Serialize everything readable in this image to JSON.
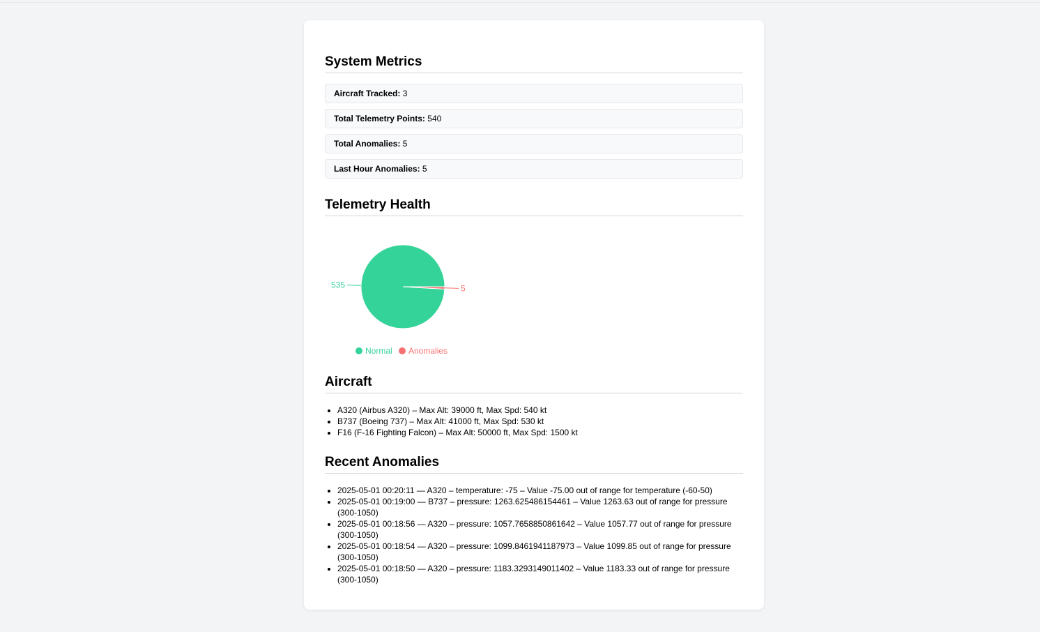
{
  "metrics": {
    "title": "System Metrics",
    "items": [
      {
        "label": "Aircraft Tracked:",
        "value": "3"
      },
      {
        "label": "Total Telemetry Points:",
        "value": "540"
      },
      {
        "label": "Total Anomalies:",
        "value": "5"
      },
      {
        "label": "Last Hour Anomalies:",
        "value": "5"
      }
    ]
  },
  "health": {
    "title": "Telemetry Health"
  },
  "chart_data": {
    "type": "pie",
    "title": "",
    "categories": [
      "Normal",
      "Anomalies"
    ],
    "values": [
      535,
      5
    ],
    "colors": [
      "#34d399",
      "#f87171"
    ],
    "data_labels": [
      "535",
      "5"
    ],
    "legend": "bottom"
  },
  "aircraft": {
    "title": "Aircraft",
    "items": [
      "A320 (Airbus A320) – Max Alt: 39000 ft, Max Spd: 540 kt",
      "B737 (Boeing 737) – Max Alt: 41000 ft, Max Spd: 530 kt",
      "F16 (F-16 Fighting Falcon) – Max Alt: 50000 ft, Max Spd: 1500 kt"
    ]
  },
  "anomalies": {
    "title": "Recent Anomalies",
    "items": [
      "2025-05-01 00:20:11 — A320 – temperature: -75 – Value -75.00 out of range for temperature (-60-50)",
      "2025-05-01 00:19:00 — B737 – pressure: 1263.625486154461 – Value 1263.63 out of range for pressure (300-1050)",
      "2025-05-01 00:18:56 — A320 – pressure: 1057.7658850861642 – Value 1057.77 out of range for pressure (300-1050)",
      "2025-05-01 00:18:54 — A320 – pressure: 1099.8461941187973 – Value 1099.85 out of range for pressure (300-1050)",
      "2025-05-01 00:18:50 — A320 – pressure: 1183.3293149011402 – Value 1183.33 out of range for pressure (300-1050)"
    ]
  }
}
